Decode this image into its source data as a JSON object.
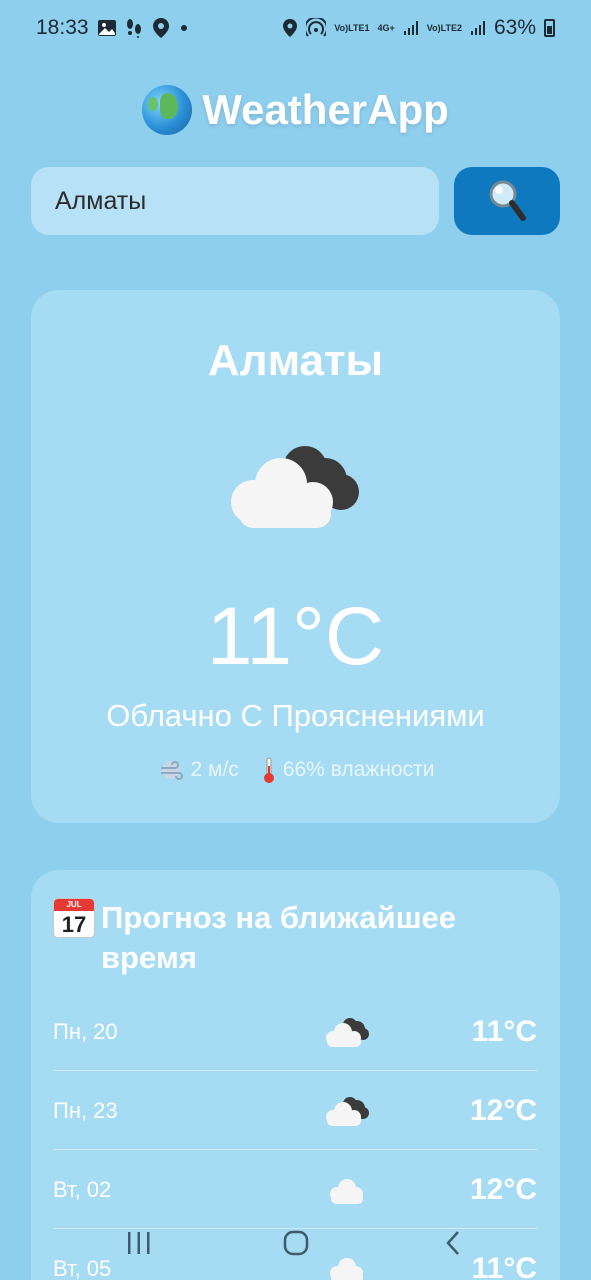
{
  "status_bar": {
    "time": "18:33",
    "battery": "63%",
    "lte1_top": "Vo)",
    "lte1_bottom": "LTE1",
    "g4_top": "4G+",
    "lte2_top": "Vo)",
    "lte2_bottom": "LTE2"
  },
  "header": {
    "title": "WeatherApp",
    "icon": "globe-icon"
  },
  "search": {
    "value": "Алматы",
    "button_icon": "search-icon"
  },
  "current": {
    "city": "Алматы",
    "icon": "cloud-icon",
    "temperature": "11°C",
    "description": "Облачно С Прояснениями",
    "wind": "2 м/с",
    "humidity": "66% влажности"
  },
  "forecast": {
    "title": "Прогноз на ближайшее время",
    "calendar_month": "JUL",
    "calendar_day": "17",
    "items": [
      {
        "day": "Пн, 20",
        "icon": "cloud-dark-icon",
        "temp": "11°C"
      },
      {
        "day": "Пн, 23",
        "icon": "cloud-dark-icon",
        "temp": "12°C"
      },
      {
        "day": "Вт, 02",
        "icon": "cloud-icon",
        "temp": "12°C"
      },
      {
        "day": "Вт, 05",
        "icon": "cloud-icon",
        "temp": "11°C"
      }
    ]
  },
  "colors": {
    "background": "#8ecfee",
    "card": "#a5dbf3",
    "button": "#0f79bf"
  }
}
